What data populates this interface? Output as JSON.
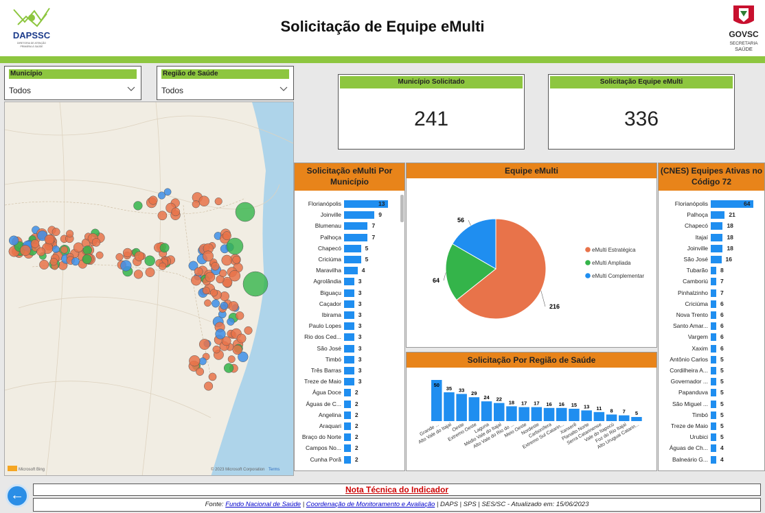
{
  "header": {
    "title": "Solicitação de Equipe eMulti",
    "logo_left_text": "DAPSSC",
    "logo_left_sub": "DIRETORIA DE ATENÇÃO PRIMÁRIA À SAÚDE",
    "logo_right_text": "GOVSC",
    "logo_right_sub1": "SECRETARIA",
    "logo_right_sub2": "SAÚDE"
  },
  "filters": {
    "municipio": {
      "label": "Município",
      "value": "Todos"
    },
    "regiao": {
      "label": "Região de Saúde",
      "value": "Todos"
    }
  },
  "map": {
    "attribution_left": "Microsoft Bing",
    "attribution_right": "© 2023 Microsoft Corporation",
    "terms_link": "Terms",
    "colors": {
      "estrategica": "#e8734a",
      "ampliada": "#34b44a",
      "complementar": "#3d8ee8"
    }
  },
  "kpis": {
    "municipio_solicitado": {
      "label": "Município Solicitado",
      "value": "241"
    },
    "solicitacao_equipe": {
      "label": "Solicitação Equipe eMulti",
      "value": "336"
    }
  },
  "panels": {
    "por_municipio_title": "Solicitação eMulti Por Município",
    "equipe_title": "Equipe eMulti",
    "cnes_title": "(CNES) Equipes Ativas no Código 72",
    "regiao_title": "Solicitação Por Região de Saúde"
  },
  "footer": {
    "nota": "Nota Técnica do Indicador",
    "fonte_prefix": "Fonte:",
    "fonte_link1": "Fundo Nacional de Saúde",
    "sep1": "|",
    "fonte_link2": "Coordenação de Monitoramento e Avaliação",
    "fonte_suffix": "| DAPS | SPS | SES/SC - Atualizado em:",
    "date": "15/06/2023",
    "back_icon": "arrow-left-icon"
  },
  "chart_data": [
    {
      "type": "bar",
      "orientation": "horizontal",
      "title": "Solicitação eMulti Por Município",
      "color": "#1f8ef0",
      "categories": [
        "Florianópolis",
        "Joinville",
        "Blumenau",
        "Palhoça",
        "Chapecó",
        "Criciúma",
        "Maravilha",
        "Agrolândia",
        "Biguaçu",
        "Caçador",
        "Ibirama",
        "Paulo Lopes",
        "Rio dos Ced...",
        "São José",
        "Timbó",
        "Três Barras",
        "Treze de Maio",
        "Água Doce",
        "Águas de C...",
        "Angelina",
        "Araquari",
        "Braço do Norte",
        "Campos No...",
        "Cunha Porã"
      ],
      "values": [
        13,
        9,
        7,
        7,
        5,
        5,
        4,
        3,
        3,
        3,
        3,
        3,
        3,
        3,
        3,
        3,
        3,
        2,
        2,
        2,
        2,
        2,
        2,
        2
      ],
      "xlim": [
        0,
        13
      ]
    },
    {
      "type": "pie",
      "title": "Equipe eMulti",
      "labels": [
        "eMulti Estratégica",
        "eMulti Ampliada",
        "eMulti Complementar"
      ],
      "values": [
        216,
        64,
        56
      ],
      "colors": [
        "#e8734a",
        "#34b44a",
        "#1f8ef0"
      ],
      "legend_position": "right"
    },
    {
      "type": "bar",
      "orientation": "horizontal",
      "title": "(CNES) Equipes Ativas no Código 72",
      "color": "#1f8ef0",
      "categories": [
        "Florianópolis",
        "Palhoça",
        "Chapecó",
        "Itajaí",
        "Joinville",
        "São José",
        "Tubarão",
        "Camboriú",
        "Pinhalzinho",
        "Criciúma",
        "Nova Trento",
        "Santo Amar...",
        "Vargem",
        "Xaxim",
        "Antônio Carlos",
        "Cordilheira A...",
        "Governador ...",
        "Papanduva",
        "São Miguel ...",
        "Timbó",
        "Treze de Maio",
        "Urubici",
        "Águas de Ch...",
        "Balneário G..."
      ],
      "values": [
        64,
        21,
        18,
        18,
        18,
        16,
        8,
        7,
        7,
        6,
        6,
        6,
        6,
        6,
        5,
        5,
        5,
        5,
        5,
        5,
        5,
        5,
        4,
        4
      ],
      "xlim": [
        0,
        64
      ]
    },
    {
      "type": "bar",
      "orientation": "vertical",
      "title": "Solicitação Por Região de Saúde",
      "color": "#1f8ef0",
      "categories": [
        "Grande ...",
        "Alto Vale do Itajaí",
        "Oeste",
        "Extremo Oeste",
        "Laguna",
        "Médio Vale do Itajaí",
        "Alto Vale do Rio do ...",
        "Meio Oeste",
        "Nordeste",
        "Carbonífera",
        "Extremo Sul Catarin...",
        "Xanxerê",
        "Planalto Norte",
        "Serra Catarinense",
        "Vale do Itapocú",
        "Foz do Rio Itajaí",
        "Alto Uruguai Catarin..."
      ],
      "values": [
        50,
        35,
        33,
        29,
        24,
        22,
        18,
        17,
        17,
        16,
        16,
        15,
        13,
        11,
        8,
        7,
        5
      ],
      "ylim": [
        0,
        50
      ]
    }
  ]
}
